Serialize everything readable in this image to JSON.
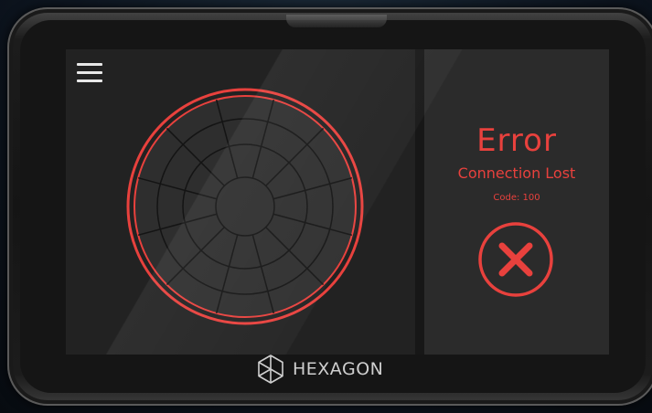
{
  "device": {
    "brand_name": "HEXAGON",
    "brand_logo_icon": "hexagon-logo-icon"
  },
  "menu": {
    "icon": "hamburger-menu-icon"
  },
  "radar": {
    "icon": "radar-target-icon",
    "ring_color": "#e8413d",
    "state": "disconnected"
  },
  "error": {
    "title": "Error",
    "message": "Connection Lost",
    "code_text": "Code: 100",
    "color": "#e8413d",
    "dismiss_icon": "close-x-icon"
  }
}
